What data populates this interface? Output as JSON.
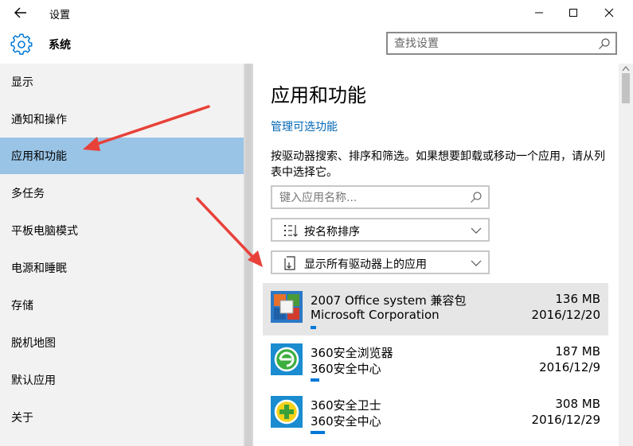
{
  "window": {
    "title": "设置",
    "icons": {
      "back": "back-arrow-icon",
      "minimize": "minimize-icon",
      "maximize": "maximize-icon",
      "close": "close-icon"
    }
  },
  "header": {
    "title": "系统",
    "icon": "gear-icon",
    "search_placeholder": "查找设置"
  },
  "sidebar": {
    "items": [
      {
        "label": "显示",
        "active": false
      },
      {
        "label": "通知和操作",
        "active": false
      },
      {
        "label": "应用和功能",
        "active": true
      },
      {
        "label": "多任务",
        "active": false
      },
      {
        "label": "平板电脑模式",
        "active": false
      },
      {
        "label": "电源和睡眠",
        "active": false
      },
      {
        "label": "存储",
        "active": false
      },
      {
        "label": "脱机地图",
        "active": false
      },
      {
        "label": "默认应用",
        "active": false
      },
      {
        "label": "关于",
        "active": false
      }
    ]
  },
  "main": {
    "title": "应用和功能",
    "manage_link": "管理可选功能",
    "description": "按驱动器搜索、排序和筛选。如果想要卸载或移动一个应用，请从列表中选择它。",
    "search_placeholder": "键入应用名称...",
    "sort_label": "按名称排序",
    "filter_label": "显示所有驱动器上的应用",
    "apps": [
      {
        "name": "2007 Office system 兼容包",
        "publisher": "Microsoft Corporation",
        "size": "136 MB",
        "date": "2016/12/20",
        "icon": "office-icon",
        "selected": true
      },
      {
        "name": "360安全浏览器",
        "publisher": "360安全中心",
        "size": "187 MB",
        "date": "2016/12/9",
        "icon": "360-browser-icon",
        "selected": false
      },
      {
        "name": "360安全卫士",
        "publisher": "360安全中心",
        "size": "308 MB",
        "date": "2016/12/29",
        "icon": "360-safe-icon",
        "selected": false
      }
    ]
  },
  "colors": {
    "accent": "#0078d7",
    "link": "#0066b4",
    "nav_active": "#99c4e6",
    "nav_bg": "#f2f2f2",
    "annotation_arrow": "#e8413a"
  }
}
